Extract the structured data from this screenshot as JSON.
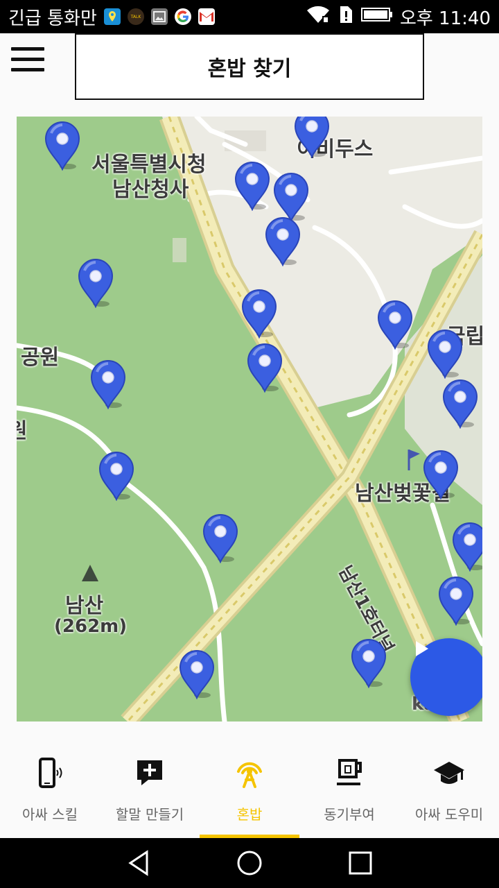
{
  "status_bar": {
    "carrier_text": "긴급 통화만",
    "time": "오후 11:40",
    "app_icons": [
      "map-pin-app-icon",
      "kakaotalk-app-icon",
      "gallery-app-icon",
      "google-app-icon",
      "gmail-app-icon"
    ],
    "kakaotalk_badge": "TALK"
  },
  "app_bar": {
    "title": "혼밥 찾기"
  },
  "map": {
    "labels": {
      "seoul_city_hall": "서울특별시청",
      "namsan_office": "남산청사",
      "park": "공원",
      "edge_text": "원",
      "idus": "이비두스",
      "national": "국립",
      "cherry_road": "남산벚꽃길",
      "tunnel": "남산1호터널",
      "mountain": "남산",
      "elevation": "(262m)",
      "kakao": "kakao"
    },
    "pin_color": "#3b5fe0"
  },
  "play_button": {
    "icon": "play-icon",
    "color": "#2c59e6"
  },
  "bottom_nav": {
    "active_color": "#f5c400",
    "items": [
      {
        "label": "아싸 스킬",
        "icon": "phone-vibrate-icon"
      },
      {
        "label": "할말 만들기",
        "icon": "add-comment-icon"
      },
      {
        "label": "혼밥",
        "icon": "broadcast-icon",
        "active": true
      },
      {
        "label": "동기부여",
        "icon": "coffee-cup-icon"
      },
      {
        "label": "아싸 도우미",
        "icon": "graduation-cap-icon"
      }
    ]
  }
}
